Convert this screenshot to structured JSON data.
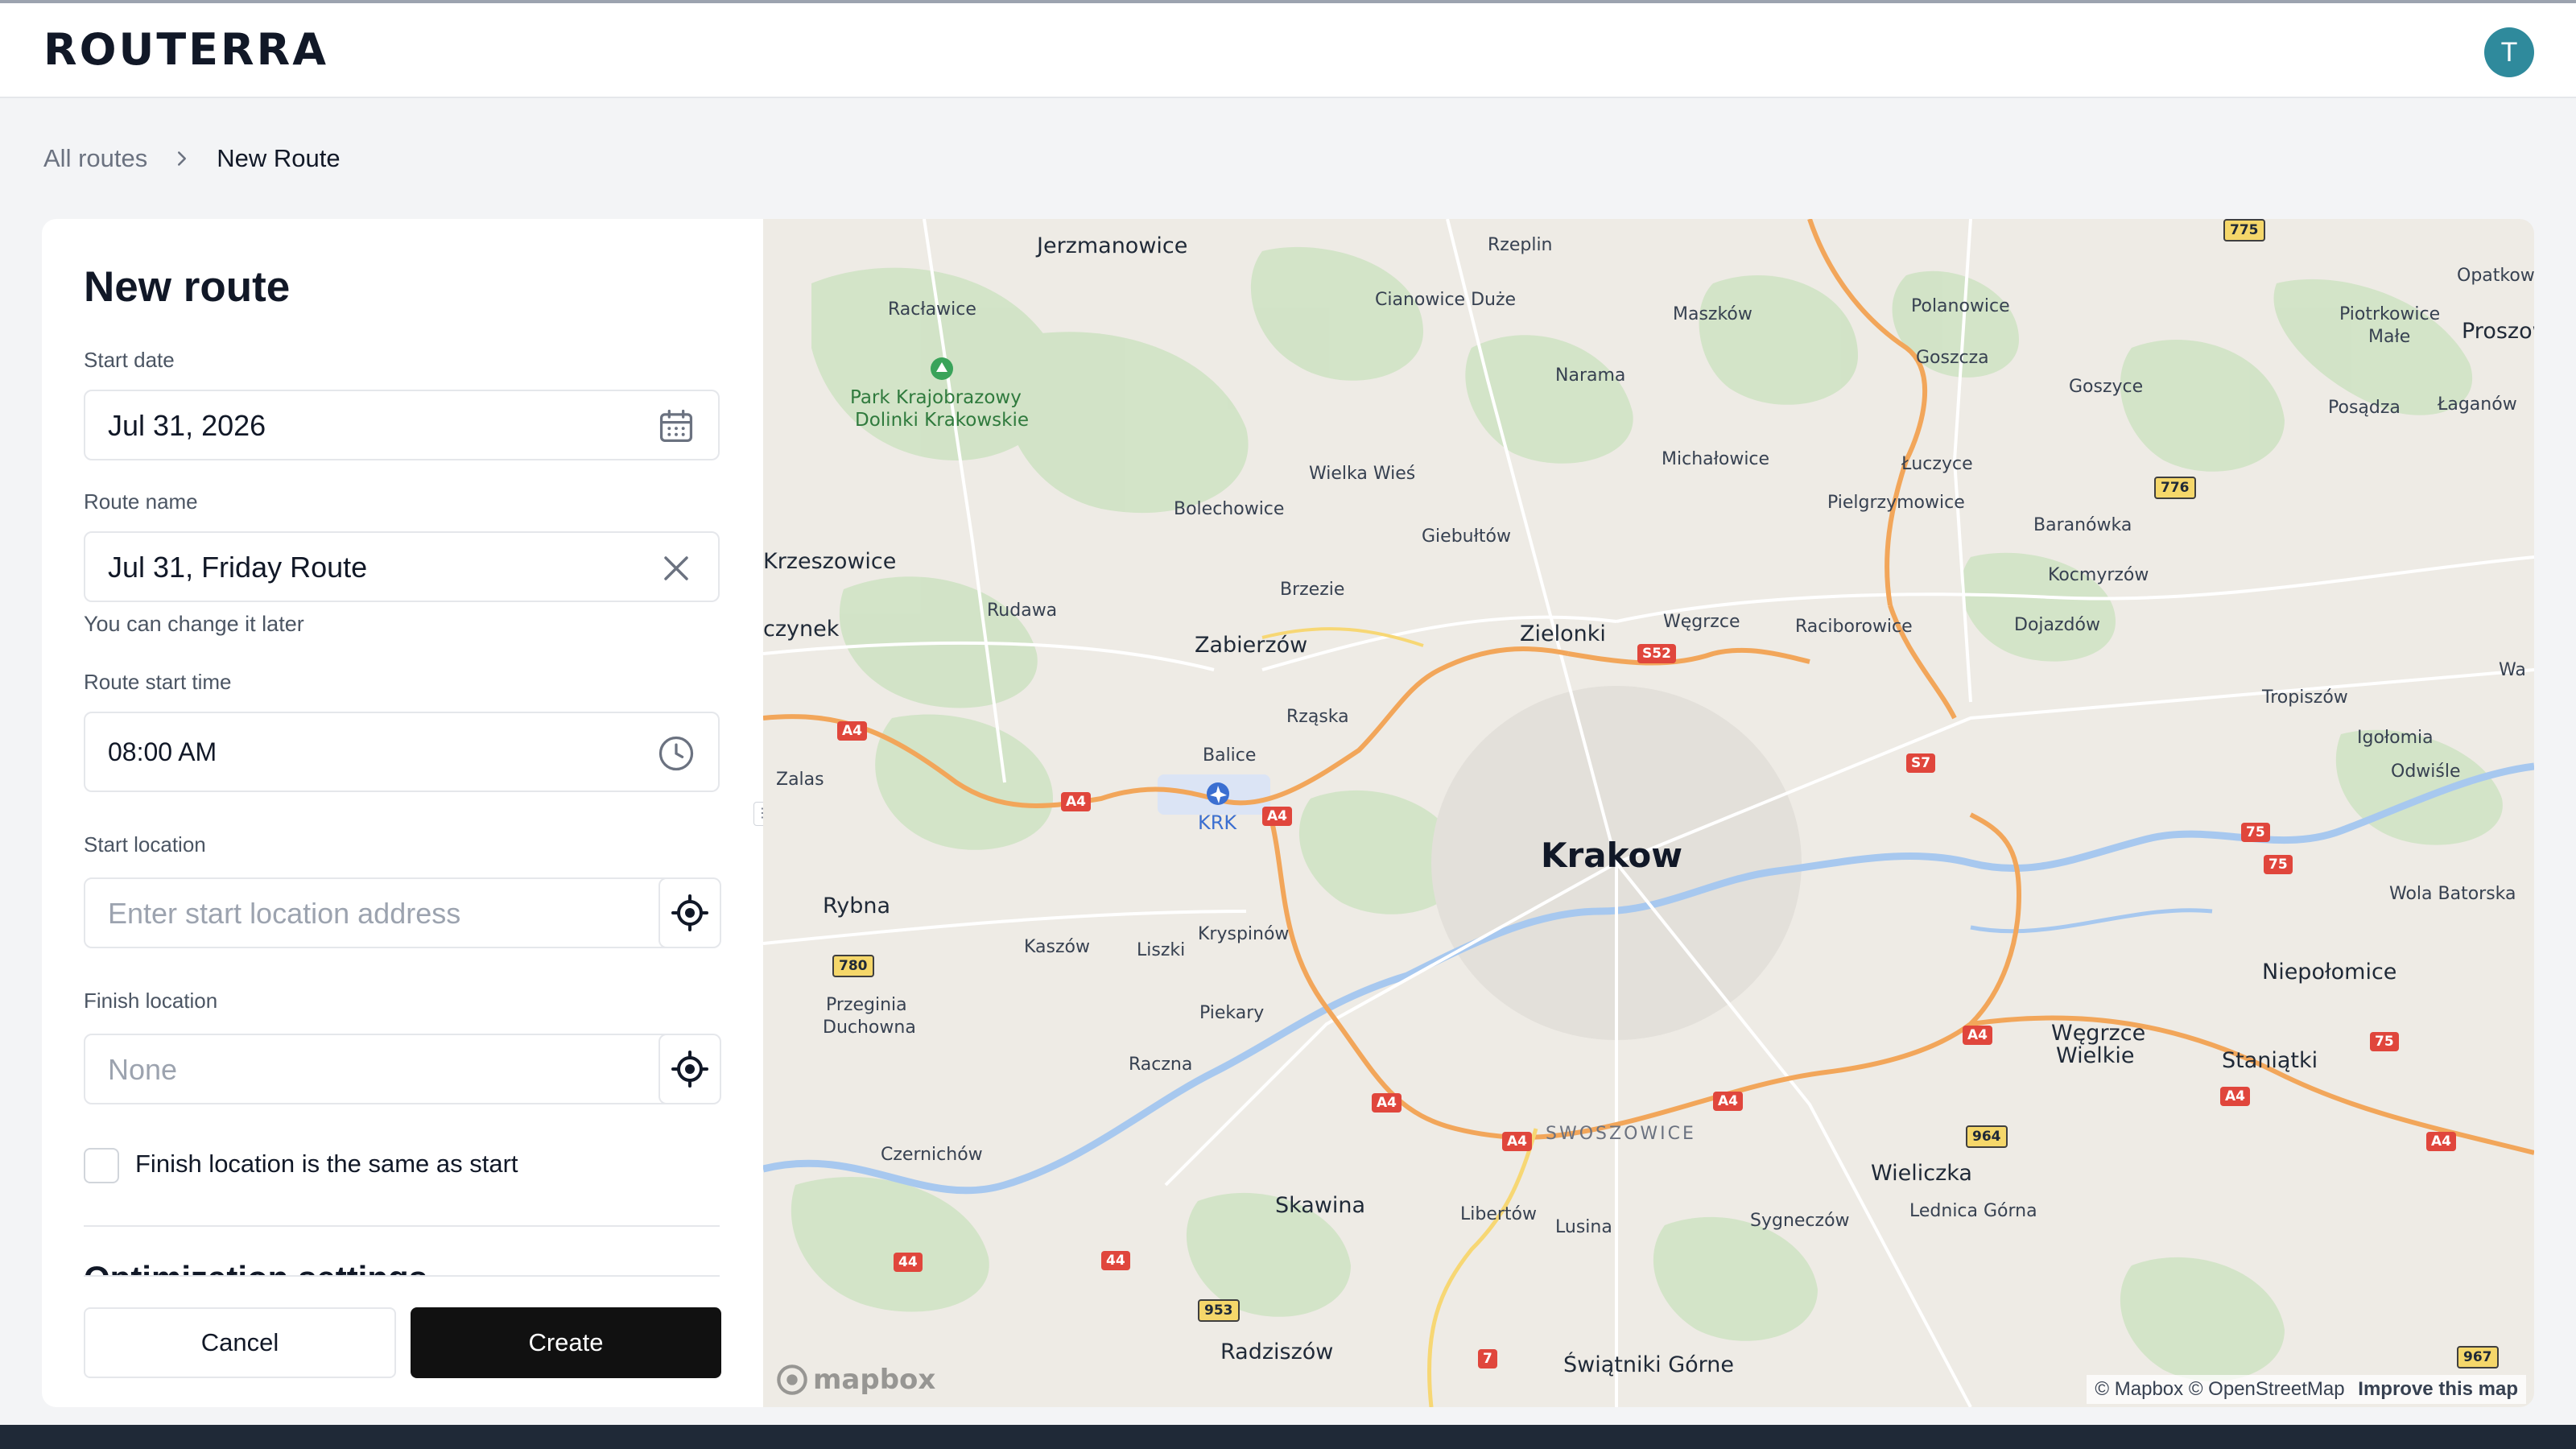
{
  "app": {
    "logo": "ROUTERRA",
    "avatar_initial": "T"
  },
  "breadcrumb": {
    "parent": "All routes",
    "current": "New Route"
  },
  "form": {
    "title": "New route",
    "start_date": {
      "label": "Start date",
      "value": "Jul 31, 2026"
    },
    "route_name": {
      "label": "Route name",
      "value": "Jul 31, Friday Route",
      "helper": "You can change it later"
    },
    "start_time": {
      "label": "Route start time",
      "value": "08:00 AM"
    },
    "start_location": {
      "label": "Start location",
      "placeholder": "Enter start location address"
    },
    "finish_location": {
      "label": "Finish location",
      "placeholder": "None"
    },
    "same_as_start": {
      "label": "Finish location is the same as start",
      "checked": false
    },
    "optimization_title": "Optimization settings",
    "cancel_label": "Cancel",
    "create_label": "Create"
  },
  "map": {
    "labels": [
      "Jerzmanowice",
      "Racławice",
      "Park Krajobrazowy",
      "Dolinki Krakowskie",
      "Rzeplin",
      "Cianowice Duże",
      "Maszków",
      "Polanowice",
      "Goszcza",
      "Goszyce",
      "Piotrkowice",
      "Małe",
      "Proszow",
      "Opatkowi",
      "Posądza",
      "Łaganów",
      "Narama",
      "Michałowice",
      "Łuczyce",
      "Pielgrzymowice",
      "Baranówka",
      "Wielka Wieś",
      "Bolechowice",
      "Giebułtów",
      "Krzeszowice",
      "Brzezie",
      "Kocmyrzów",
      "Dojazdów",
      "Rudawa",
      "Zabierzów",
      "Zielonki",
      "Węgrzce",
      "Raciborowice",
      "czynek",
      "Rząska",
      "Tropiszów",
      "Igołomia",
      "Odwiśle",
      "Wa",
      "Zalas",
      "Balice",
      "KRK",
      "Krakow",
      "Rybna",
      "Wola Batorska",
      "Kaszów",
      "Liszki",
      "Kryspinów",
      "Niepołomice",
      "Przeginia",
      "Duchowna",
      "Piekary",
      "Węgrzce",
      "Wielkie",
      "Staniątki",
      "Raczna",
      "SWOSZOWICE",
      "Czernichów",
      "Wieliczka",
      "Lednica Górna",
      "Skawina",
      "Libertów",
      "Lusina",
      "Sygneczów",
      "Radziszów",
      "Świątniki Górne"
    ],
    "road_shields": [
      "775",
      "776",
      "S52",
      "S7",
      "A4",
      "780",
      "75",
      "964",
      "953",
      "7",
      "44",
      "967"
    ],
    "attribution_prefix": "© Mapbox © OpenStreetMap",
    "attribution_link": "Improve this map",
    "provider_logo": "mapbox"
  }
}
